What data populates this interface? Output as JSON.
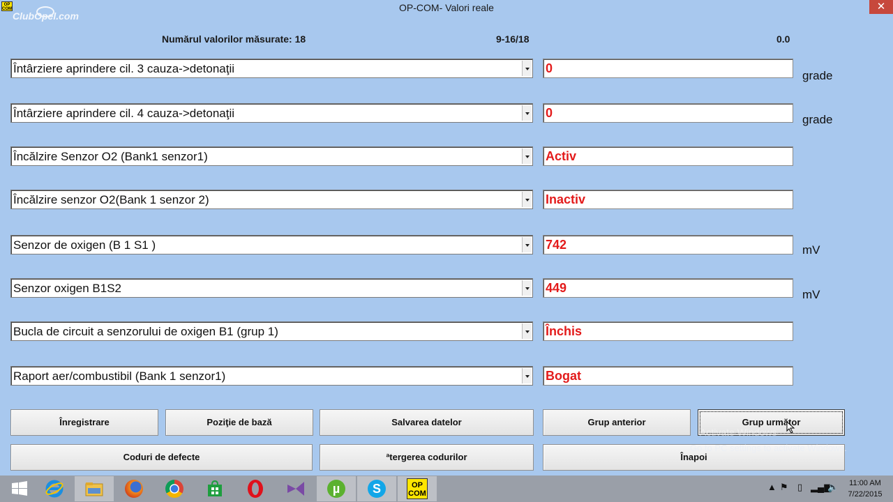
{
  "window": {
    "title": "OP-COM- Valori reale",
    "close_label": "✕",
    "app_icon_text": "OP COM"
  },
  "watermark": "ClubOpel.com",
  "header": {
    "measured_count_label": "Numărul valorilor măsurate: 18",
    "range": "9-16/18",
    "value": "0.0"
  },
  "rows": [
    {
      "label": "Întârziere aprindere cil. 3 cauza->detonaţii",
      "value": "0",
      "unit": "grade"
    },
    {
      "label": "Întârziere aprindere cil. 4 cauza->detonaţii",
      "value": "0",
      "unit": "grade"
    },
    {
      "label": "Încălzire Senzor O2 (Bank1 senzor1)",
      "value": "Activ",
      "unit": ""
    },
    {
      "label": "Încălzire senzor O2(Bank 1 senzor 2)",
      "value": "Inactiv",
      "unit": ""
    },
    {
      "label": "Senzor de oxigen  (B 1 S1 )",
      "value": "742",
      "unit": "mV"
    },
    {
      "label": "Senzor oxigen  B1S2",
      "value": "449",
      "unit": "mV"
    },
    {
      "label": "Bucla de circuit a senzorului de oxigen B1 (grup 1)",
      "value": "Închis",
      "unit": ""
    },
    {
      "label": "Raport aer/combustibil (Bank 1 senzor1)",
      "value": "Bogat",
      "unit": ""
    }
  ],
  "buttons": {
    "record": "Înregistrare",
    "base_position": "Poziţie de bază",
    "save_data": "Salvarea datelor",
    "prev_group": "Grup anterior",
    "next_group": "Grup următor",
    "fault_codes": "Coduri de defecte",
    "clear_codes": "ªtergerea codurilor",
    "back": "Înapoi"
  },
  "activation_notice": "Go to PC settings to activate Windows.",
  "activation_ghost": "Activate Windows",
  "taskbar": {
    "items": [
      "start-icon",
      "internet-explorer-icon",
      "file-explorer-icon",
      "firefox-icon",
      "chrome-icon",
      "store-icon",
      "opera-icon",
      "visual-studio-icon",
      "utorrent-icon",
      "skype-icon",
      "opcom-icon"
    ],
    "opcom_text": "OP COM",
    "time": "11:00 AM",
    "date": "7/22/2015"
  },
  "colors": {
    "background": "#a8c8ee",
    "value_text": "#e31b1b"
  }
}
